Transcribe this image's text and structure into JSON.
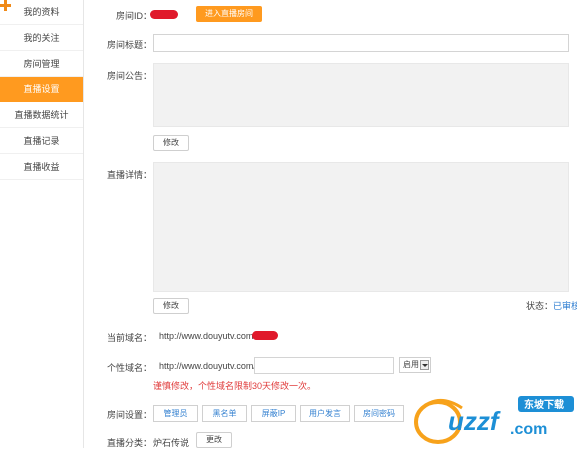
{
  "sidebar": {
    "items": [
      {
        "label": "我的资料"
      },
      {
        "label": "我的关注"
      },
      {
        "label": "房间管理"
      },
      {
        "label": "直播设置",
        "active": true
      },
      {
        "label": "直播数据统计"
      },
      {
        "label": "直播记录"
      },
      {
        "label": "直播收益"
      }
    ]
  },
  "room": {
    "id_label": "房间ID：",
    "enter_button": "进入直播房间",
    "title_label": "房间标题：",
    "title_value": "",
    "notice_label": "房间公告：",
    "notice_edit": "修改",
    "detail_label": "直播详情：",
    "detail_edit": "修改",
    "status_label": "状态：",
    "status_value": "已审核"
  },
  "domain": {
    "current_label": "当前域名：",
    "current_value": "http://www.douyutv.com/",
    "custom_label": "个性域名：",
    "custom_prefix": "http://www.douyutv.com/",
    "custom_value": "",
    "enable_option": "启用",
    "warning": "谨慎修改，个性域名限制30天修改一次。"
  },
  "settings": {
    "label": "房间设置：",
    "buttons": [
      "管理员",
      "黑名单",
      "屏蔽IP",
      "用户发言",
      "房间密码"
    ]
  },
  "category": {
    "label": "直播分类：",
    "value": "炉石传说",
    "change_button": "更改"
  },
  "watermark": {
    "brand": "uzzf",
    "domain": ".com",
    "tagline": "东坡下载"
  },
  "colors": {
    "accent": "#ff9a1f",
    "link": "#2a7bd0",
    "warning": "#e03b3b"
  }
}
